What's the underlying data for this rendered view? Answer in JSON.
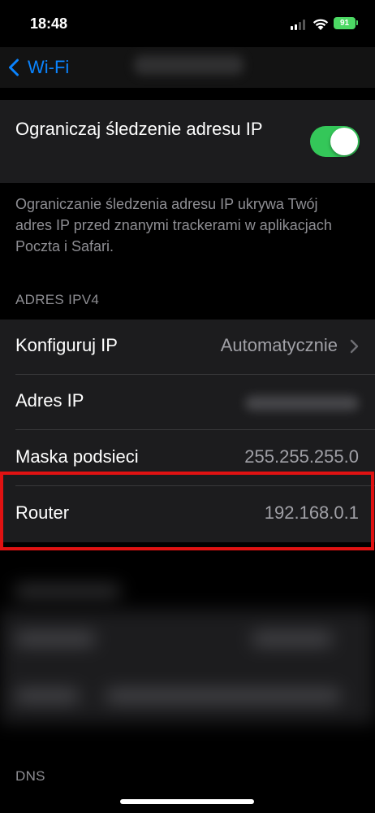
{
  "status_bar": {
    "time": "18:48",
    "battery": "91",
    "icons": [
      "cellular-signal-icon",
      "wifi-icon",
      "battery-charging-icon"
    ]
  },
  "nav": {
    "back_label": "Wi-Fi",
    "back_icon": "chevron-left-icon"
  },
  "privacy": {
    "toggle_label": "Ograniczaj śledzenie adresu IP",
    "toggle_on": true,
    "footer": "Ograniczanie śledzenia adresu IP ukrywa Twój adres IP przed znanymi trackerami w aplikacjach Poczta i Safari."
  },
  "ipv4": {
    "header": "ADRES IPV4",
    "rows": [
      {
        "label": "Konfiguruj IP",
        "value": "Automatycznie",
        "chevron": true
      },
      {
        "label": "Adres IP",
        "value": "",
        "blurred": true
      },
      {
        "label": "Maska podsieci",
        "value": "255.255.255.0"
      },
      {
        "label": "Router",
        "value": "192.168.0.1"
      }
    ]
  },
  "dns": {
    "header": "DNS"
  },
  "colors": {
    "background": "#000000",
    "cell": "#1c1c1e",
    "accent": "#0a84ff",
    "toggle_on": "#34c759",
    "secondary_text": "#8e8e93",
    "highlight": "#e01212"
  }
}
